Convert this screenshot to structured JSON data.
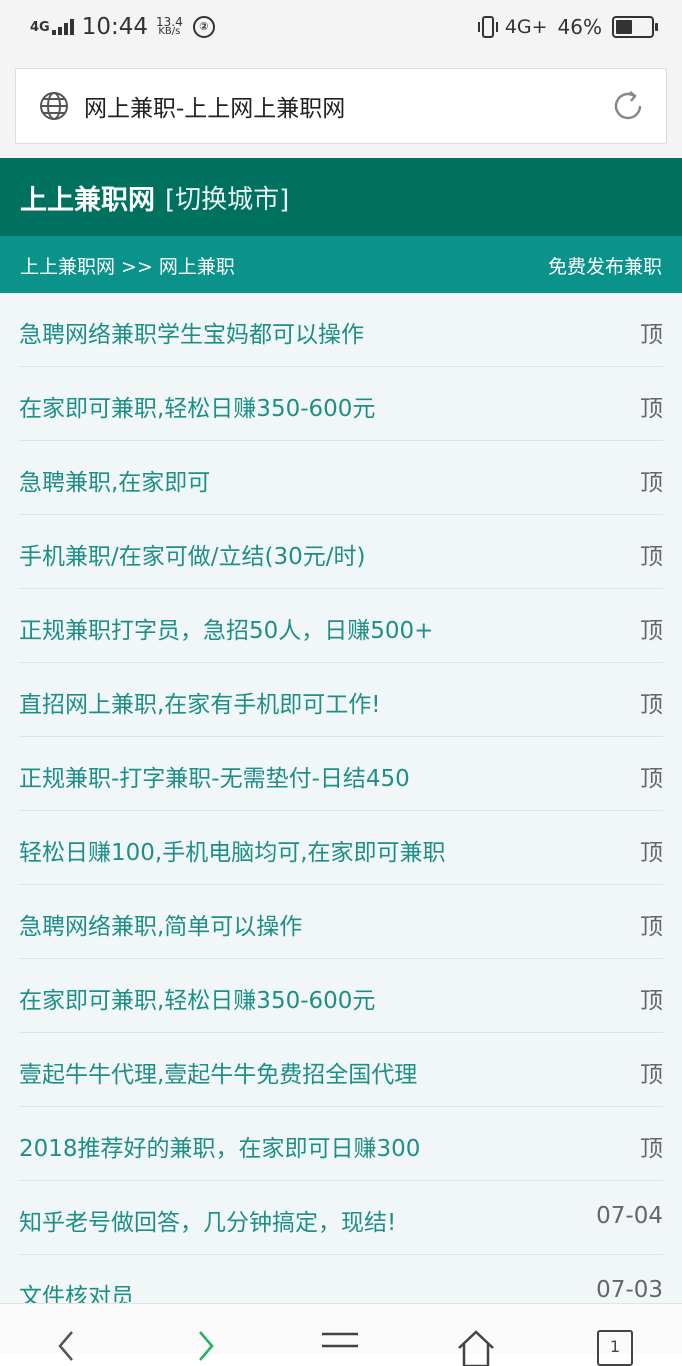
{
  "status": {
    "network_left": "4G",
    "time": "10:44",
    "speed_value": "13.4",
    "speed_unit": "KB/s",
    "badge": "②",
    "network_right": "4G+",
    "battery_percent": "46%",
    "battery_level": 0.46
  },
  "browser": {
    "url_title": "网上兼职-上上网上兼职网"
  },
  "header": {
    "site_name": "上上兼职网",
    "switch_city": "[切换城市]"
  },
  "breadcrumb": {
    "path": "上上兼职网 >> 网上兼职",
    "publish": "免费发布兼职"
  },
  "jobs": [
    {
      "title": "急聘网络兼职学生宝妈都可以操作",
      "tag": "顶"
    },
    {
      "title": "在家即可兼职,轻松日赚350-600元",
      "tag": "顶"
    },
    {
      "title": "急聘兼职,在家即可",
      "tag": "顶"
    },
    {
      "title": "手机兼职/在家可做/立结(30元/时)",
      "tag": "顶"
    },
    {
      "title": "正规兼职打字员，急招50人，日赚500+",
      "tag": "顶"
    },
    {
      "title": "直招网上兼职,在家有手机即可工作!",
      "tag": "顶"
    },
    {
      "title": "正规兼职-打字兼职-无需垫付-日结450",
      "tag": "顶"
    },
    {
      "title": "轻松日赚100,手机电脑均可,在家即可兼职",
      "tag": "顶"
    },
    {
      "title": "急聘网络兼职,简单可以操作",
      "tag": "顶"
    },
    {
      "title": "在家即可兼职,轻松日赚350-600元",
      "tag": "顶"
    },
    {
      "title": "壹起牛牛代理,壹起牛牛免费招全国代理",
      "tag": "顶"
    },
    {
      "title": "2018推荐好的兼职，在家即可日赚300",
      "tag": "顶"
    },
    {
      "title": "知乎老号做回答，几分钟搞定，现结!",
      "tag": "07-04"
    },
    {
      "title": "文件核对员",
      "tag": "07-03"
    }
  ],
  "bottom_nav": {
    "tab_count": "1"
  }
}
